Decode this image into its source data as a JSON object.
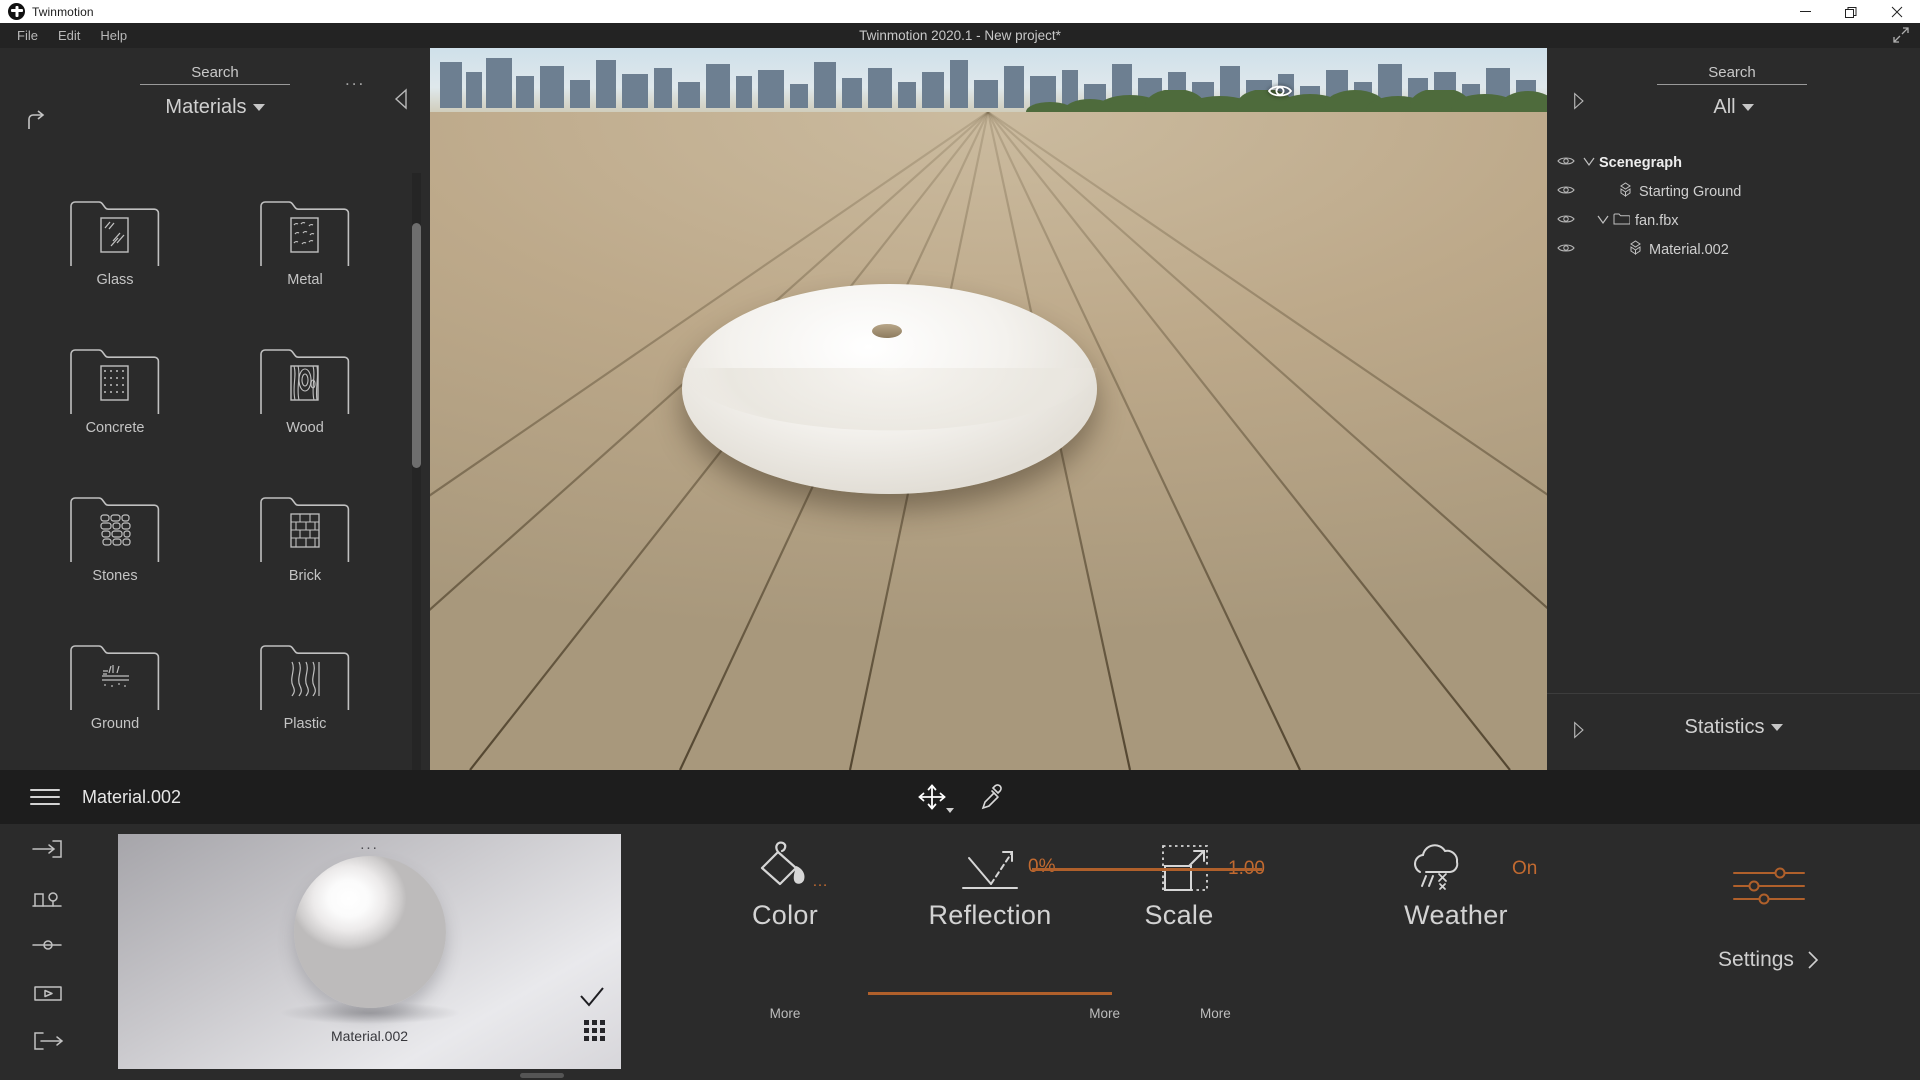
{
  "window": {
    "app_name": "Twinmotion",
    "title": "Twinmotion 2020.1 - New project*",
    "controls": {
      "minimize": "minimize-icon",
      "restore": "restore-icon",
      "close": "close-icon"
    }
  },
  "menubar": {
    "items": [
      "File",
      "Edit",
      "Help"
    ]
  },
  "library": {
    "search_placeholder": "Search",
    "category": "Materials",
    "more_menu": "...",
    "folders": [
      {
        "label": "Glass",
        "icon": "folder-glass-icon"
      },
      {
        "label": "Metal",
        "icon": "folder-metal-icon"
      },
      {
        "label": "Concrete",
        "icon": "folder-concrete-icon"
      },
      {
        "label": "Wood",
        "icon": "folder-wood-icon"
      },
      {
        "label": "Stones",
        "icon": "folder-stones-icon"
      },
      {
        "label": "Brick",
        "icon": "folder-brick-icon"
      },
      {
        "label": "Ground",
        "icon": "folder-ground-icon"
      },
      {
        "label": "Plastic",
        "icon": "folder-plastic-icon"
      }
    ]
  },
  "scenegraph": {
    "search_placeholder": "Search",
    "filter": "All",
    "tree": [
      {
        "name": "Scenegraph",
        "indent": 0,
        "bold": true,
        "chevron": "v",
        "icon": "",
        "eye": true
      },
      {
        "name": "Starting Ground",
        "indent": 1,
        "bold": false,
        "chevron": "",
        "icon": "mesh-icon",
        "eye": true
      },
      {
        "name": "fan.fbx",
        "indent": 1,
        "bold": false,
        "chevron": "v",
        "icon": "folder-icon",
        "eye": true
      },
      {
        "name": "Material.002",
        "indent": 2,
        "bold": false,
        "chevron": "",
        "icon": "mesh-icon",
        "eye": true
      }
    ],
    "statistics_label": "Statistics"
  },
  "viewport": {
    "visibility_toggle": "eye-icon"
  },
  "dock": {
    "material_name": "Material.002",
    "tools": [
      {
        "name": "move-tool",
        "icon": "move-gizmo-icon"
      },
      {
        "name": "pipette-tool",
        "icon": "eyedropper-icon"
      }
    ],
    "rail_icons": [
      "import-icon",
      "object-placement-icon",
      "slider-icon",
      "media-icon",
      "export-icon"
    ],
    "preview": {
      "label": "Material.002",
      "menu_dots": "...",
      "apply_check": "check-icon",
      "grid_toggle": "grid-icon"
    },
    "properties": [
      {
        "name": "Color",
        "value": "",
        "icon": "paint-bucket-icon",
        "more": "More",
        "has_slider": false,
        "has_dots": true
      },
      {
        "name": "Reflection",
        "value": "0%",
        "icon": "reflection-icon",
        "more": "More",
        "has_slider": true,
        "slider_fill": 100,
        "has_dots": false
      },
      {
        "name": "Scale",
        "value": "1.00",
        "icon": "scale-icon",
        "more": "More",
        "has_slider": true,
        "slider_fill": 100,
        "has_dots": false
      },
      {
        "name": "Weather",
        "value": "On",
        "icon": "weather-rain-icon",
        "more": "",
        "has_slider": false,
        "has_dots": false
      }
    ],
    "settings": {
      "label": "Settings",
      "icon": "sliders-icon",
      "chevron": "chevron-right-icon"
    }
  },
  "colors": {
    "accent_orange": "#b0602b",
    "value_orange": "#c26a30",
    "panel_bg": "#2b2b2b",
    "dock_header_bg": "#1d1d1d",
    "titlebar_bg": "#ffffff",
    "menubar_bg": "#232323",
    "text": "#cfcfcf"
  }
}
